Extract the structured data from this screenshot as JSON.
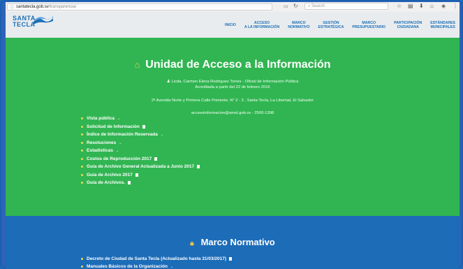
{
  "browser": {
    "url_domain": "santatecla.gob.sv",
    "url_path": "/transparencia/",
    "search_placeholder": "Search"
  },
  "header": {
    "logo_line1": "SANTA",
    "logo_line2": "TECLA",
    "nav": [
      {
        "label": "INICIO"
      },
      {
        "label": "ACCESO\nA LA INFORMACIÓN"
      },
      {
        "label": "MARCO\nNORMATIVO"
      },
      {
        "label": "GESTIÓN\nESTRATÉGICA"
      },
      {
        "label": "MARCO\nPRESUPUESTARIO"
      },
      {
        "label": "PARTICIPACIÓN\nCIUDADANA"
      },
      {
        "label": "ESTÁNDARES\nMUNICIPALES"
      }
    ]
  },
  "unit": {
    "title": "Unidad de Acceso a la Información",
    "officer": "Licda. Carmen Elena Rodríguez Torres - Oficial de Información Pública",
    "accredited": "Acreditada a partir del 22 de febrero 2016",
    "address": "2ª Avenida Norte y Primera Calle Poniente, N° 2 - 3 , Santa Tecla, La Libertad, El Salvador",
    "contact": "accesoinformacion@amst.gob.sv - 2500-1398",
    "links": [
      {
        "label": "Vista pública",
        "suffix": "⌄"
      },
      {
        "label": "Solicitud de Información",
        "doc": true
      },
      {
        "label": "Índice de Información Reservada",
        "suffix": "⌄"
      },
      {
        "label": "Resoluciones",
        "suffix": "⌄"
      },
      {
        "label": "Estadísticas",
        "suffix": "⌄"
      },
      {
        "label": "Costos de Reproducción 2017",
        "doc": true
      },
      {
        "label": "Guía de Archivo General Actualizada a Junio 2017",
        "doc": true
      },
      {
        "label": "Guía de Archivo 2017",
        "doc": true
      },
      {
        "label": "Guía de Archivos.",
        "doc": true
      }
    ]
  },
  "marco": {
    "title": "Marco Normativo",
    "links": [
      {
        "label": "Decreto de Ciudad de Santa Tecla (Actualizado hasta 31/03/2017)",
        "doc": true
      },
      {
        "label": "Manuales Básicos de la Organización",
        "suffix": "⌄"
      }
    ]
  },
  "colors": {
    "green": "#31b552",
    "blue": "#1c6cb8",
    "accent_yellow": "#f2d94a"
  }
}
